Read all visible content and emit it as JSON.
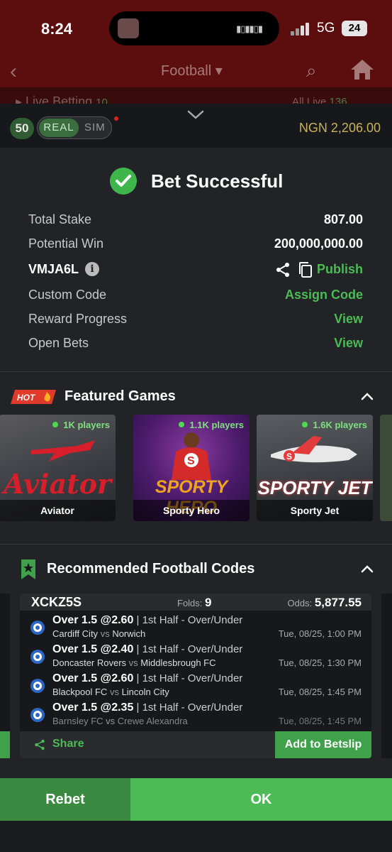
{
  "status_bar": {
    "time": "8:24",
    "network": "5G",
    "battery": "24"
  },
  "background_nav": {
    "title": "Football",
    "strip_left": "Live Betting",
    "strip_left_count": "10",
    "strip_right": "All Live",
    "strip_right_count": "136"
  },
  "account": {
    "level": "50",
    "mode_real": "REAL",
    "mode_sim": "SIM",
    "balance": "NGN 2,206.00"
  },
  "bet_success": {
    "title": "Bet Successful",
    "rows": [
      {
        "label": "Total Stake",
        "value": "807.00"
      },
      {
        "label": "Potential Win",
        "value": "200,000,000.00"
      }
    ],
    "booking_code": "VMJA6L",
    "publish_label": "Publish",
    "custom_code_label": "Custom Code",
    "assign_code_label": "Assign Code",
    "reward_progress_label": "Reward Progress",
    "reward_view_label": "View",
    "open_bets_label": "Open Bets",
    "open_bets_view_label": "View"
  },
  "featured_games": {
    "hot_badge": "HOT",
    "title": "Featured Games",
    "games": [
      {
        "name": "Aviator",
        "players": "1K players",
        "art": "Aviator",
        "color": "#d81e2a"
      },
      {
        "name": "Sporty Hero",
        "players": "1.1K players",
        "art": "SPORTY HERO",
        "color": "#f0a31c"
      },
      {
        "name": "Sporty Jet",
        "players": "1.6K players",
        "art": "SPORTY JET",
        "color": "#e23b3b"
      }
    ]
  },
  "recommended": {
    "title": "Recommended Football Codes",
    "card": {
      "code": "XCKZ5S",
      "folds_label": "Folds:",
      "folds": "9",
      "odds_label": "Odds:",
      "odds": "5,877.55",
      "selections": [
        {
          "pick": "Over 1.5 @2.60",
          "market": "| 1st Half - Over/Under",
          "home": "Cardiff City",
          "away": "Norwich",
          "time": "Tue, 08/25, 1:00 PM"
        },
        {
          "pick": "Over 1.5 @2.40",
          "market": "| 1st Half - Over/Under",
          "home": "Doncaster Rovers",
          "away": "Middlesbrough FC",
          "time": "Tue, 08/25, 1:30 PM"
        },
        {
          "pick": "Over 1.5 @2.60",
          "market": "| 1st Half - Over/Under",
          "home": "Blackpool FC",
          "away": "Lincoln City",
          "time": "Tue, 08/25, 1:45 PM"
        },
        {
          "pick": "Over 1.5 @2.35",
          "market": "| 1st Half - Over/Under",
          "home": "Barnsley FC",
          "away": "Crewe Alexandra",
          "time": "Tue, 08/25, 1:45 PM"
        }
      ],
      "vs": "vs",
      "share_label": "Share",
      "add_label": "Add to Betslip"
    }
  },
  "actions": {
    "rebet": "Rebet",
    "ok": "OK"
  },
  "colors": {
    "accent_green": "#4cbb55",
    "balance_gold": "#c8b25a",
    "bg_app_red": "#5c0d0d"
  }
}
